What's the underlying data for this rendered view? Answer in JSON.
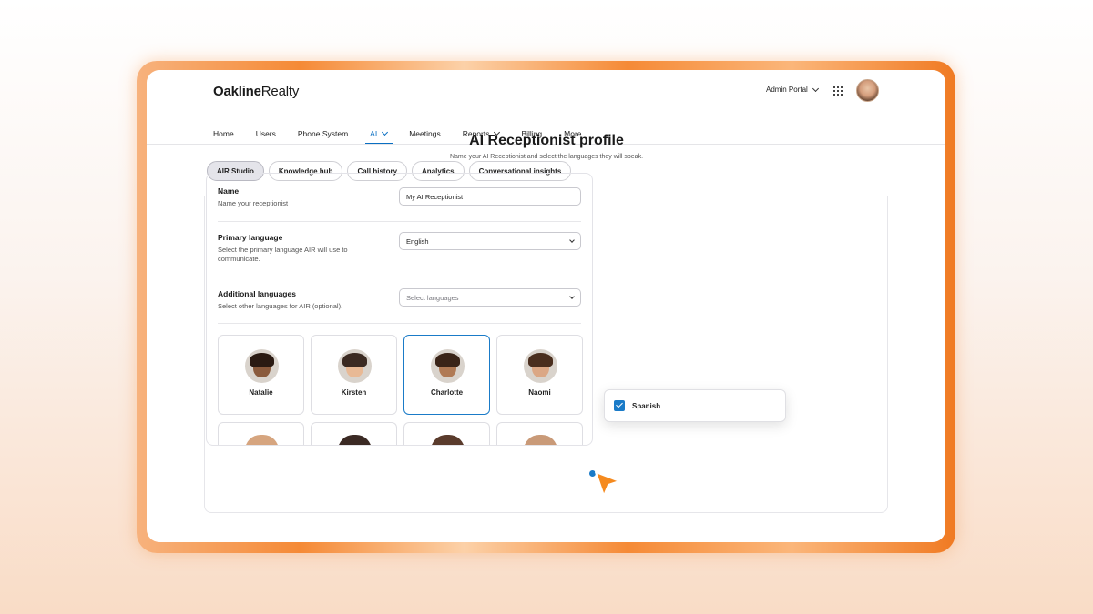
{
  "brand": {
    "name_bold": "Oakline",
    "name_rest": "Realty"
  },
  "header": {
    "portal_label": "Admin Portal"
  },
  "nav": {
    "items": [
      {
        "label": "Home"
      },
      {
        "label": "Users"
      },
      {
        "label": "Phone System"
      },
      {
        "label": "AI"
      },
      {
        "label": "Meetings"
      },
      {
        "label": "Reports"
      },
      {
        "label": "Billing"
      },
      {
        "label": "More"
      }
    ],
    "active": "AI"
  },
  "subtabs": [
    {
      "label": "AIR Studio"
    },
    {
      "label": "Knowledge hub"
    },
    {
      "label": "Call history"
    },
    {
      "label": "Analytics"
    },
    {
      "label": "Conversational insights"
    }
  ],
  "profile": {
    "title": "AI Receptionist profile",
    "subtitle": "Name your AI Receptionist and select the languages they will speak.",
    "name": {
      "label": "Name",
      "help": "Name your receptionist",
      "value": "My AI Receptionist"
    },
    "primary_language": {
      "label": "Primary language",
      "help": "Select the primary language AIR will use to communicate.",
      "value": "English"
    },
    "additional_languages": {
      "label": "Additional languages",
      "help": "Select other languages for AIR (optional).",
      "placeholder": "Select languages"
    }
  },
  "dropdown": {
    "option": "Spanish",
    "checked": true
  },
  "personas": [
    {
      "name": "Natalie"
    },
    {
      "name": "Kirsten"
    },
    {
      "name": "Charlotte",
      "selected": true
    },
    {
      "name": "Naomi"
    }
  ],
  "colors": {
    "accent": "#1a7bc8",
    "frame": "#f58a36",
    "cursor": "#f58a1f"
  }
}
